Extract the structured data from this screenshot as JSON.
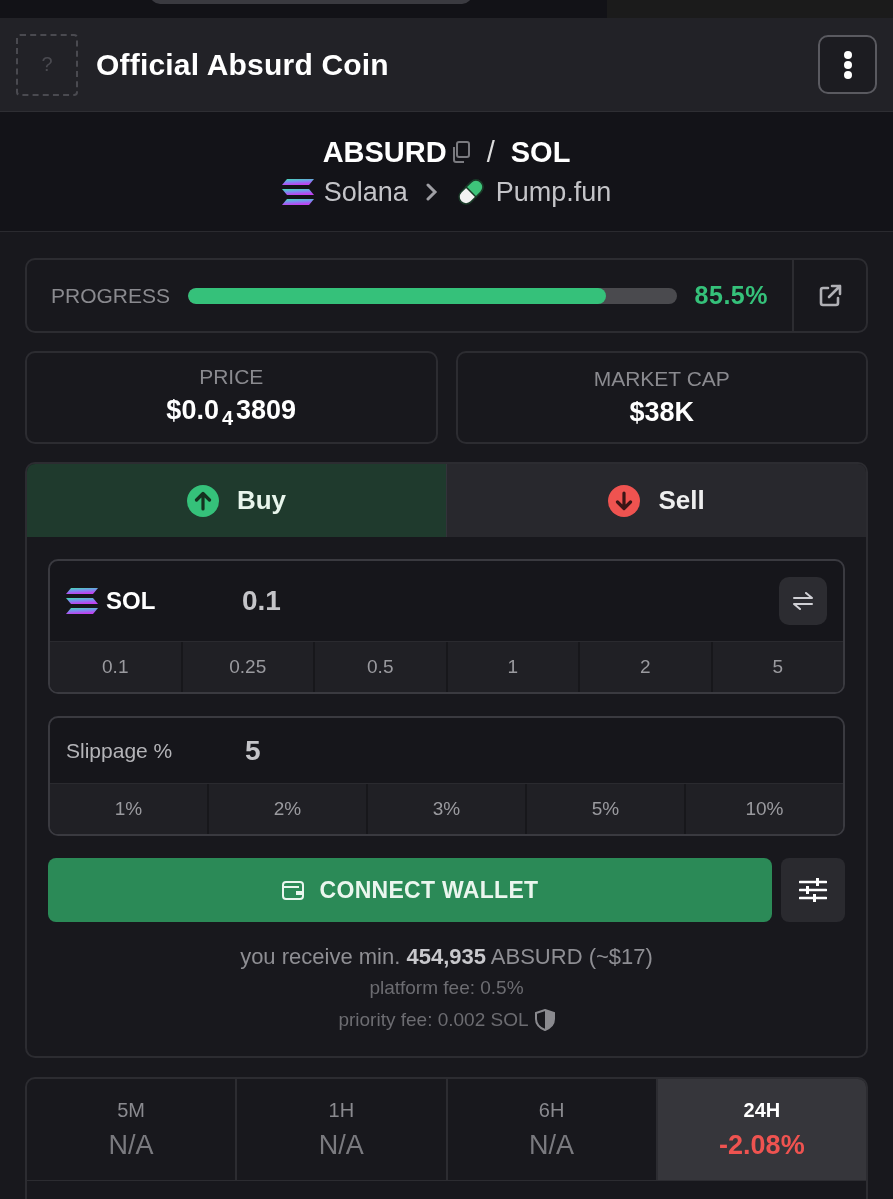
{
  "header": {
    "logo_placeholder": "?",
    "title": "Official Absurd Coin"
  },
  "pair": {
    "base": "ABSURD",
    "separator": "/",
    "quote": "SOL",
    "chain": "Solana",
    "platform": "Pump.fun"
  },
  "progress": {
    "label": "PROGRESS",
    "level": 0.855,
    "reading": "85.5%"
  },
  "stats": [
    {
      "label": "PRICE",
      "value": "$0.0$_{4}$3809"
    },
    {
      "label": "MARKET CAP",
      "value": "$38K"
    }
  ],
  "trade_tabs": [
    {
      "kind": "buy",
      "label": "Buy",
      "selected": true
    },
    {
      "kind": "sell",
      "label": "Sell",
      "selected": false
    }
  ],
  "amount": {
    "token": "SOL",
    "value": "0.1",
    "presets": [
      "0.1",
      "0.25",
      "0.5",
      "1",
      "2",
      "5"
    ]
  },
  "slippage": {
    "label": "Slippage %",
    "value": "5",
    "presets": [
      "1%",
      "2%",
      "3%",
      "5%",
      "10%"
    ]
  },
  "connect_button": "CONNECT WALLET",
  "receive_note": "you receive min. **454,935** ABSURD (~$17)",
  "platform_fee": "platform fee: 0.5%",
  "priority_fee": "priority fee: 0.002 SOL",
  "timeframes": [
    {
      "label": "5M",
      "value": "N/A",
      "kind": "neutral",
      "selected": false
    },
    {
      "label": "1H",
      "value": "N/A",
      "kind": "neutral",
      "selected": false
    },
    {
      "label": "6H",
      "value": "N/A",
      "kind": "neutral",
      "selected": false
    },
    {
      "label": "24H",
      "value": "-2.08%",
      "kind": "negative",
      "selected": true
    }
  ]
}
